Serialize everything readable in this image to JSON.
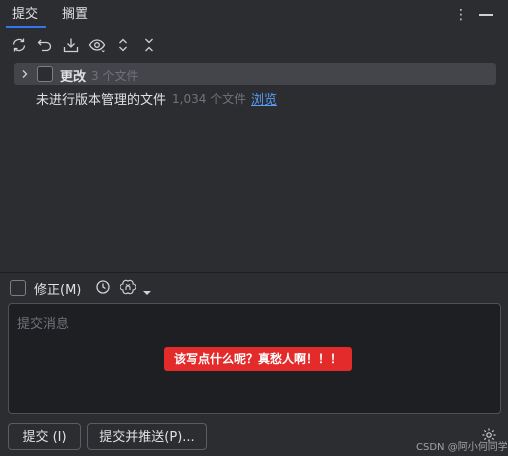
{
  "tabs": [
    {
      "label": "提交"
    },
    {
      "label": "搁置"
    }
  ],
  "toolbar": {
    "icons": [
      "refresh-icon",
      "rollback-icon",
      "shelve-icon",
      "show-diff-icon",
      "expand-all-icon",
      "collapse-all-icon"
    ]
  },
  "changes": {
    "label": "更改",
    "count": "3 个文件"
  },
  "unversioned": {
    "label": "未进行版本管理的文件",
    "count": "1,034 个文件",
    "link": "浏览"
  },
  "commit_options": {
    "amend_label": "修正(M)"
  },
  "message": {
    "placeholder": "提交消息",
    "annotation": "该写点什么呢？真愁人啊！！！"
  },
  "buttons": {
    "commit": "提交 (I)",
    "commit_push": "提交并推送(P)..."
  },
  "watermark": "CSDN @阿小何同学",
  "colors": {
    "accent": "#3574f0",
    "link": "#589df6",
    "annotation_bg": "#e32b2b"
  }
}
